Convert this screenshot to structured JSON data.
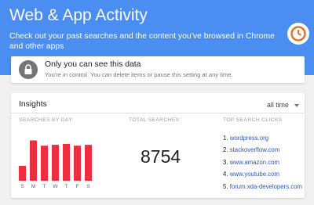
{
  "header": {
    "title": "Web & App Activity",
    "subtitle": "Check out your past searches and the content you’ve browsed in Chrome and other apps",
    "color": "#4a8ef2",
    "clock_icon": "clock-icon"
  },
  "privacy": {
    "title": "Only you can see this data",
    "description": "You're in control. You can delete items or pause this setting at any time.",
    "icon": "lock-icon"
  },
  "insights": {
    "title": "Insights",
    "range": "all time",
    "searches_by_day_label": "SEARCHES BY DAY",
    "total_searches_label": "TOTAL SEARCHES",
    "total_searches": "8754",
    "top_clicks_label": "TOP SEARCH CLICKS",
    "top_clicks": [
      {
        "rank": "1.",
        "site": "wordpress.org"
      },
      {
        "rank": "2.",
        "site": "stackoverflow.com"
      },
      {
        "rank": "3.",
        "site": "www.amazon.com"
      },
      {
        "rank": "4.",
        "site": "www.youtube.com"
      },
      {
        "rank": "5.",
        "site": "forum.xda-developers.com"
      }
    ]
  },
  "chart_data": {
    "type": "bar",
    "categories": [
      "S",
      "M",
      "T",
      "W",
      "T",
      "F",
      "S"
    ],
    "values": [
      0.34,
      0.92,
      0.8,
      0.82,
      0.84,
      0.8,
      0.82
    ],
    "ylim": [
      0,
      1
    ],
    "bar_color": "#ee2e3f"
  }
}
